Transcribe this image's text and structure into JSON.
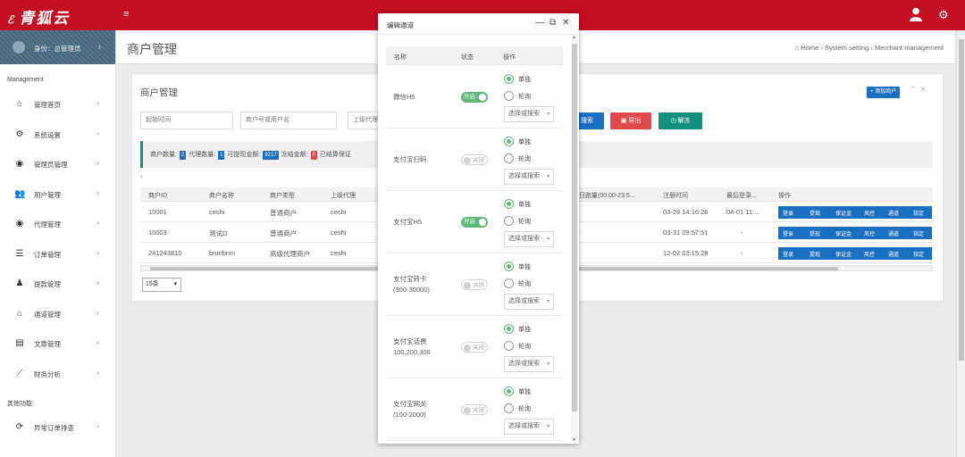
{
  "app": {
    "logo_text": "青狐云"
  },
  "header": {
    "menu_icon": "hamburger-icon",
    "user_icon": "user-icon",
    "settings_icon": "gear-icon"
  },
  "sidebar": {
    "profile_label": "身份：总管理员",
    "section1": "Management",
    "items": [
      {
        "label": "管理首页",
        "icon": "home-icon"
      },
      {
        "label": "系统设置",
        "icon": "settings-icon"
      },
      {
        "label": "管理员管理",
        "icon": "admin-icon"
      },
      {
        "label": "用户管理",
        "icon": "users-icon"
      },
      {
        "label": "代理管理",
        "icon": "agent-icon"
      },
      {
        "label": "订单管理",
        "icon": "list-icon"
      },
      {
        "label": "提款管理",
        "icon": "withdraw-icon"
      },
      {
        "label": "通道管理",
        "icon": "bank-icon"
      },
      {
        "label": "文章管理",
        "icon": "book-icon"
      },
      {
        "label": "财务分析",
        "icon": "chart-icon"
      }
    ],
    "section2": "其他功能",
    "extra_items": [
      {
        "label": "异常订单排查",
        "icon": "refresh-icon"
      }
    ]
  },
  "page": {
    "title": "商户管理",
    "breadcrumb": [
      "Home",
      "System setting",
      "Merchant management"
    ]
  },
  "panel": {
    "title": "商户管理",
    "add_button": "添加商户",
    "filters": {
      "start_time_placeholder": "起始时间",
      "merchant_placeholder": "商户号或用户名",
      "agent_placeholder": "上级代理"
    },
    "buttons": {
      "search": "搜索",
      "export": "导出",
      "unfreeze": "解冻"
    },
    "stats": {
      "merchant_count_label": "商户数量:",
      "merchant_count": "2",
      "agent_count_label": "代理数量:",
      "agent_count": "1",
      "withdrawable_label": "可提现金额:",
      "withdrawable": "9217",
      "frozen_label": "冻结金额:",
      "frozen": "0",
      "margin_label": "已结算保证"
    },
    "table": {
      "columns": [
        "商户ID",
        "商户名称",
        "商户类型",
        "上级代理",
        "日跑量(00:00-23:5...",
        "注册时间",
        "最后登录...",
        "操作"
      ],
      "rows": [
        {
          "id": "10001",
          "name": "ceshi",
          "type": "普通商户",
          "agent": "ceshi",
          "reg_time": "03-28 14:16:26",
          "last_login": "04-01 11:..."
        },
        {
          "id": "10003",
          "name": "测试D",
          "type": "普通商户",
          "agent": "ceshi",
          "reg_time": "03-31 09:57:51",
          "last_login": "-"
        },
        {
          "id": "241243810",
          "name": "bnmbnm",
          "type": "高级代理商户",
          "agent": "ceshi",
          "reg_time": "12-02 03:15:28",
          "last_login": "-"
        }
      ],
      "actions": [
        "登录",
        "提现",
        "保证金",
        "风控",
        "通道",
        "指定"
      ]
    },
    "page_size": "15条"
  },
  "modal": {
    "title": "编辑通道",
    "columns": [
      "名称",
      "状态",
      "操作"
    ],
    "radio_single": "单独",
    "radio_poll": "轮询",
    "select_placeholder": "选择或搜索",
    "toggle_on": "开启",
    "toggle_off": "关闭",
    "channels": [
      {
        "name": "微信H5",
        "enabled": true
      },
      {
        "name": "支付宝扫码",
        "enabled": false
      },
      {
        "name": "支付宝H5",
        "enabled": true
      },
      {
        "name": "支付宝转卡\n(300-30000)",
        "enabled": false
      },
      {
        "name": "支付宝话费\n100,200,300",
        "enabled": false
      },
      {
        "name": "支付宝网关\n(100-2000)",
        "enabled": false
      }
    ]
  },
  "colors": {
    "brand": "#c40e22",
    "primary_blue": "#1b6fc0",
    "green": "#5fb878",
    "teal": "#14907e",
    "danger": "#e04a4a"
  }
}
